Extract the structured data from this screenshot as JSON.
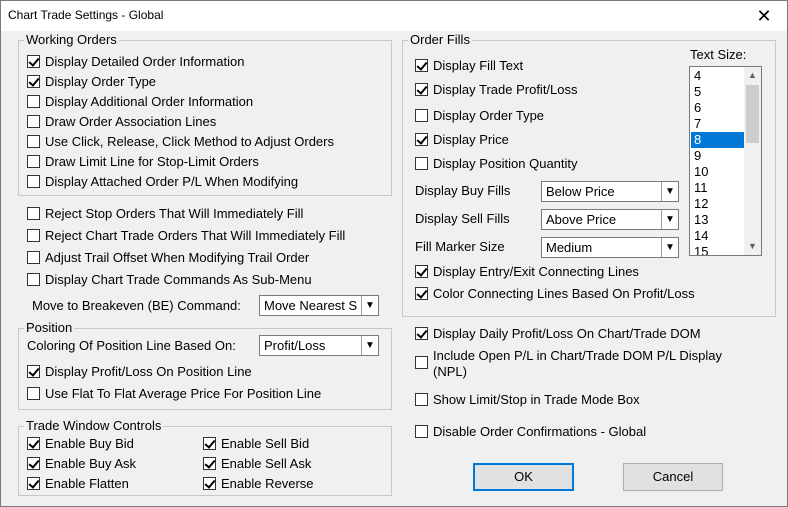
{
  "window": {
    "title": "Chart Trade Settings - Global",
    "close_glyph": "✕"
  },
  "working_orders": {
    "legend": "Working Orders",
    "items": [
      {
        "label": "Display Detailed Order Information",
        "checked": true
      },
      {
        "label": "Display Order Type",
        "checked": true
      },
      {
        "label": "Display Additional Order Information",
        "checked": false
      },
      {
        "label": "Draw Order Association Lines",
        "checked": false
      },
      {
        "label": "Use Click, Release, Click Method to Adjust Orders",
        "checked": false
      },
      {
        "label": "Draw Limit Line for Stop-Limit Orders",
        "checked": false
      },
      {
        "label": "Display Attached Order P/L When Modifying",
        "checked": false
      }
    ]
  },
  "misc": {
    "items": [
      {
        "label": "Reject Stop Orders That Will Immediately Fill",
        "checked": false
      },
      {
        "label": "Reject Chart Trade Orders That Will Immediately Fill",
        "checked": false
      },
      {
        "label": "Adjust Trail Offset When Modifying Trail Order",
        "checked": false
      },
      {
        "label": "Display Chart Trade Commands As Sub-Menu",
        "checked": false
      }
    ],
    "breakeven_label": "Move to Breakeven (BE) Command:",
    "breakeven_value": "Move Nearest S"
  },
  "position": {
    "legend": "Position",
    "coloring_label": "Coloring Of Position Line Based On:",
    "coloring_value": "Profit/Loss",
    "items": [
      {
        "label": "Display Profit/Loss On Position Line",
        "checked": true
      },
      {
        "label": "Use Flat To Flat Average Price For Position Line",
        "checked": false
      }
    ]
  },
  "trade_window": {
    "legend": "Trade Window Controls",
    "items": [
      {
        "label": "Enable Buy Bid",
        "checked": true
      },
      {
        "label": "Enable Sell Bid",
        "checked": true
      },
      {
        "label": "Enable Buy Ask",
        "checked": true
      },
      {
        "label": "Enable Sell Ask",
        "checked": true
      },
      {
        "label": "Enable Flatten",
        "checked": true
      },
      {
        "label": "Enable Reverse",
        "checked": true
      }
    ]
  },
  "order_fills": {
    "legend": "Order Fills",
    "items": [
      {
        "label": "Display Fill Text",
        "checked": true
      },
      {
        "label": "Display Trade Profit/Loss",
        "checked": true
      },
      {
        "label": "Display Order Type",
        "checked": false
      },
      {
        "label": "Display Price",
        "checked": true
      },
      {
        "label": "Display Position Quantity",
        "checked": false
      }
    ],
    "buy_fills_label": "Display Buy Fills",
    "buy_fills_value": "Below Price",
    "sell_fills_label": "Display Sell Fills",
    "sell_fills_value": "Above Price",
    "marker_size_label": "Fill Marker Size",
    "marker_size_value": "Medium",
    "lines_items": [
      {
        "label": "Display Entry/Exit Connecting Lines",
        "checked": true
      },
      {
        "label": "Color Connecting Lines Based On Profit/Loss",
        "checked": true
      }
    ],
    "text_size_label": "Text Size:",
    "text_sizes": [
      "4",
      "5",
      "6",
      "7",
      "8",
      "9",
      "10",
      "11",
      "12",
      "13",
      "14",
      "15"
    ],
    "text_size_selected": "8"
  },
  "right_misc": {
    "items": [
      {
        "label": "Display Daily Profit/Loss On Chart/Trade DOM",
        "checked": true
      },
      {
        "label": "Include Open P/L in Chart/Trade DOM P/L Display",
        "label2": "(NPL)",
        "checked": false
      },
      {
        "label": "Show Limit/Stop in Trade Mode Box",
        "checked": false
      },
      {
        "label": "Disable Order Confirmations - Global",
        "checked": false
      }
    ]
  },
  "buttons": {
    "ok": "OK",
    "cancel": "Cancel"
  }
}
